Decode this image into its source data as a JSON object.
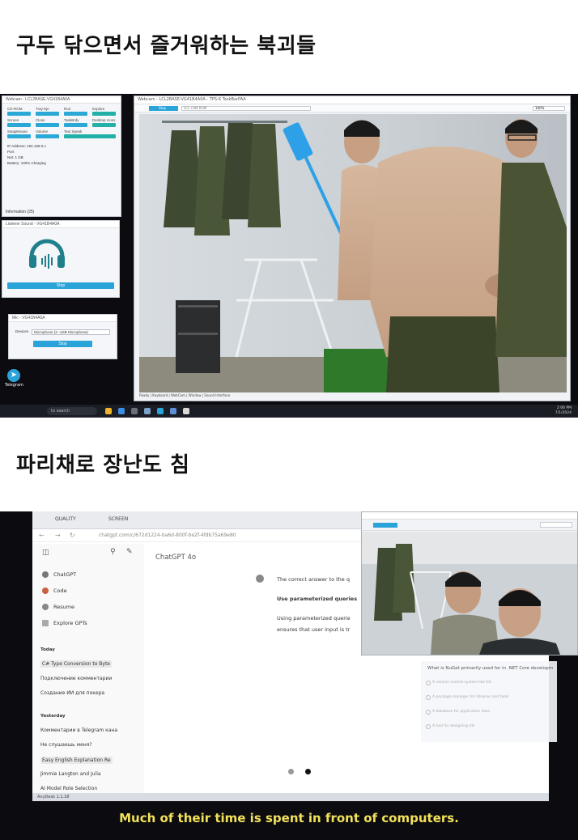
{
  "headings": {
    "top": "구두 닦으면서 즐거워하는 북괴들",
    "middle": "파리채로 장난도 침"
  },
  "screenshot1": {
    "control_window": {
      "title": "Webcam - LCL2BASE-VG41B4A0A",
      "cells": [
        "CD-ROM",
        "Tray Eje",
        "Run",
        "Explore",
        "Screen",
        "Close",
        "TaskBrdy",
        "Desktop Icons",
        "SwapMouse",
        "Volume",
        "Text Speak",
        ""
      ],
      "status": [
        "IP Address: 192.168.0.x",
        "Port",
        "Net: 1 GB",
        "Battery: 100% Charging"
      ],
      "info_label": "Information (25)"
    },
    "sound_window": {
      "title": "Listener Sound - VG41B4A0A",
      "button": "Stop"
    },
    "mic_window": {
      "title": "Mic - VG41B4A0A",
      "label": "Devices",
      "device": "Microphone (2- USB Microphone)",
      "button": "Stop"
    },
    "telegram_label": "Telegram",
    "webcam_window": {
      "title": "Webcam - LCL2BASE-VG41B4A0A - TPS-K TaskBarPAA",
      "button": "Stop",
      "field": "LCL CAM ROM",
      "dropdown": "100%",
      "status": "Ready | Keyboard | WebCam | Window | Sound Interface"
    },
    "taskbar": {
      "search": "to search",
      "time": "2:06 PM",
      "date": "7/1/2024"
    }
  },
  "screenshot2": {
    "toolbar": {
      "quality": "QUALITY",
      "screen": "SCREEN"
    },
    "address": "chatgpt.com/c/672d1224-ba6d-800f-be2f-4fdb75a69e80",
    "sidebar": {
      "items": [
        "ChatGPT",
        "Code",
        "Resume",
        "Explore GPTs"
      ],
      "today_label": "Today",
      "today": [
        "C# Type Conversion to Byte",
        "Подключение комментарии",
        "Создание ИИ для покера"
      ],
      "yesterday_label": "Yesterday",
      "yesterday": [
        "Комментарии в Telegram кана",
        "Не слушаешь меня?",
        "Easy English Explanation Re",
        "Jimmie Langton and Julia",
        "AI Model Role Selection"
      ]
    },
    "chat": {
      "model": "ChatGPT 4o",
      "line1": "The correct answer to the q",
      "line2": "Use parameterized queries",
      "line3": "Using parameterized querie",
      "line4": "ensures that user input is tr"
    },
    "quiz": {
      "question": "What is NuGet primarily used for in .NET Core developm",
      "options": [
        "A version control system like Git",
        "A package manager for libraries and tools",
        "A database for application data",
        "A tool for designing UIs"
      ]
    },
    "taskbar": "AnyDesk 1.1.18",
    "subtitle": "Much of their time is spent in front of computers."
  },
  "colors": {
    "accent": "#2aa3d8",
    "subtitle": "#f2e25a"
  }
}
